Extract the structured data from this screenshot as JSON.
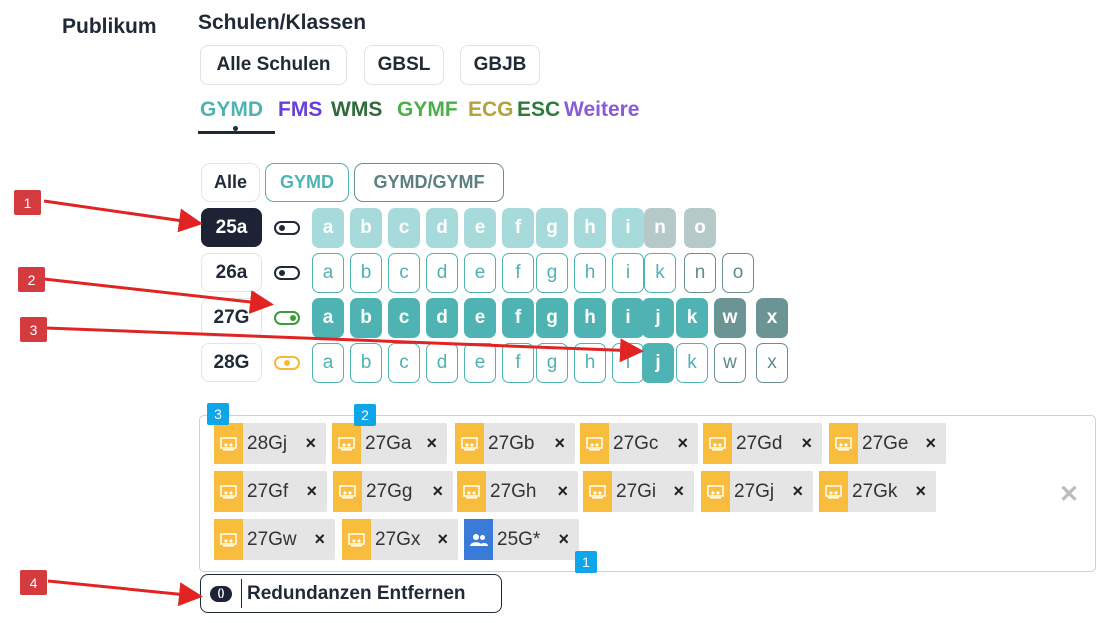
{
  "labels": {
    "publikum": "Publikum",
    "schulen_klassen": "Schulen/Klassen"
  },
  "schools": [
    "Alle Schulen",
    "GBSL",
    "GBJB"
  ],
  "dept_tabs": [
    {
      "label": "GYMD",
      "color": "#4fb3b3"
    },
    {
      "label": "FMS",
      "color": "#6a3fd6"
    },
    {
      "label": "WMS",
      "color": "#2f6b3a"
    },
    {
      "label": "GYMF",
      "color": "#4bb04b"
    },
    {
      "label": "ECG",
      "color": "#b3a23d"
    },
    {
      "label": "ESC",
      "color": "#2f7a3a"
    },
    {
      "label": "Weitere",
      "color": "#8a5bd6"
    }
  ],
  "filters": [
    "Alle",
    "GYMD",
    "GYMD/GYMF"
  ],
  "years": [
    {
      "label": "25a",
      "letters": [
        "a",
        "b",
        "c",
        "d",
        "e",
        "f",
        "g",
        "h",
        "i",
        "n",
        "o"
      ]
    },
    {
      "label": "26a",
      "letters": [
        "a",
        "b",
        "c",
        "d",
        "e",
        "f",
        "g",
        "h",
        "i",
        "k",
        "n",
        "o"
      ]
    },
    {
      "label": "27G",
      "letters": [
        "a",
        "b",
        "c",
        "d",
        "e",
        "f",
        "g",
        "h",
        "i",
        "j",
        "k",
        "w",
        "x"
      ]
    },
    {
      "label": "28G",
      "letters": [
        "a",
        "b",
        "c",
        "d",
        "e",
        "f",
        "g",
        "h",
        "i",
        "j",
        "k",
        "w",
        "x"
      ]
    }
  ],
  "toggle_states": [
    "off",
    "off",
    "on",
    "partial"
  ],
  "toggle_colors": [
    "#1f2937",
    "#1f2937",
    "#3a9d3a",
    "#f5b83a"
  ],
  "chips": [
    "28Gj",
    "27Ga",
    "27Gb",
    "27Gc",
    "27Gd",
    "27Ge",
    "27Gf",
    "27Gg",
    "27Gh",
    "27Gi",
    "27Gj",
    "27Gk",
    "27Gw",
    "27Gx",
    "25G*"
  ],
  "chip_icons": [
    "school-class-icon",
    "user-group-icon"
  ],
  "remove_glyph": "×",
  "clear_glyph": "✕",
  "badges": [
    "3",
    "2",
    "1"
  ],
  "markers": [
    "1",
    "2",
    "3",
    "4"
  ],
  "redundancy_button": {
    "label": "Redundanzen Entfernen",
    "icon": "()"
  }
}
